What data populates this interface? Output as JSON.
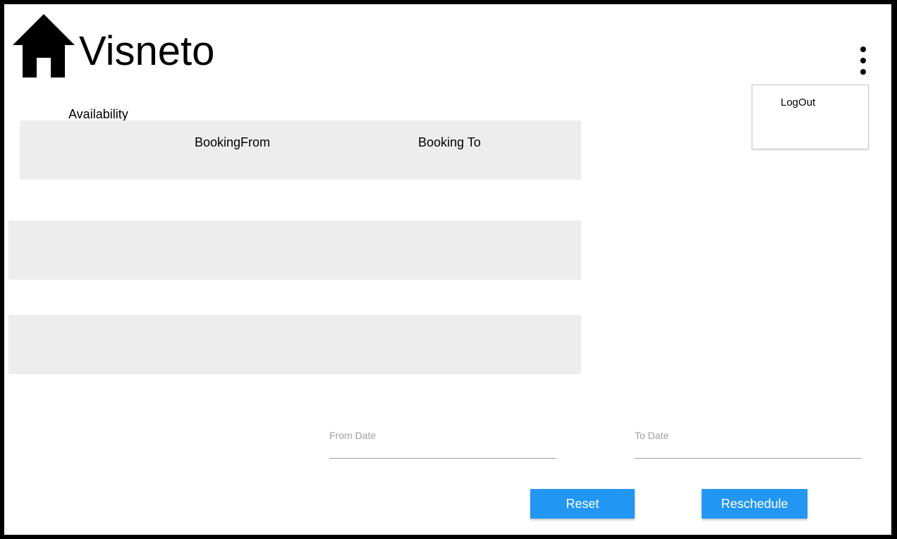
{
  "header": {
    "app_title": "Visneto",
    "logo_icon": "home-icon",
    "menu_icon": "kebab-menu-icon"
  },
  "menu": {
    "items": [
      {
        "label": "LogOut"
      }
    ]
  },
  "availability": {
    "section_label": "Availability",
    "columns": [
      "",
      "BookingFrom",
      "Booking To"
    ],
    "rows": [
      [],
      [],
      [],
      []
    ]
  },
  "form": {
    "from_date": {
      "label": "From Date",
      "value": ""
    },
    "to_date": {
      "label": "To Date",
      "value": ""
    }
  },
  "actions": {
    "reset_label": "Reset",
    "reschedule_label": "Reschedule"
  },
  "colors": {
    "primary": "#2196f3",
    "row_stripe": "#ededed",
    "frame": "#000000",
    "field_label": "#9e9e9e"
  }
}
